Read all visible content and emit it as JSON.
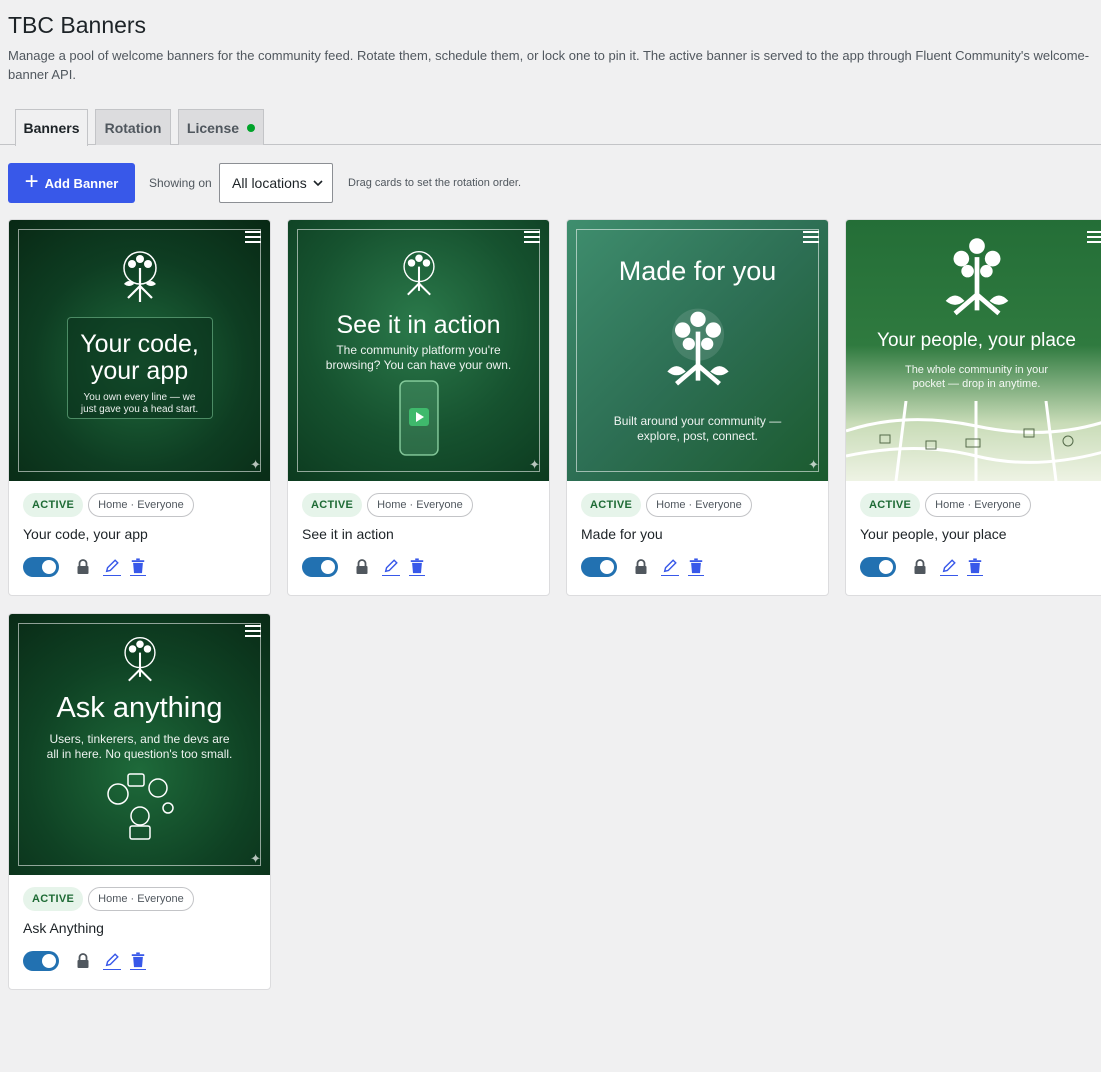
{
  "page": {
    "title": "TBC Banners",
    "description": "Manage a pool of welcome banners for the community feed. Rotate them, schedule them, or lock one to pin it. The active banner is served to the app through Fluent Community's welcome-banner API."
  },
  "tabs": [
    {
      "label": "Banners",
      "active": true
    },
    {
      "label": "Rotation",
      "active": false
    },
    {
      "label": "License",
      "active": false,
      "status_color": "#00a32a"
    }
  ],
  "toolbar": {
    "add_label": "Add Banner",
    "showing_label": "Showing on",
    "location_value": "All locations",
    "drag_hint": "Drag cards to set the rotation order."
  },
  "colors": {
    "accent": "#3858e9",
    "toggle_on": "#2271b1",
    "active_badge_bg": "#e6f4ea",
    "active_badge_text": "#1e6b35"
  },
  "cards": [
    {
      "title": "Your code, your app",
      "status": "ACTIVE",
      "location": "Home · Everyone",
      "enabled": true,
      "banner": {
        "headline_1": "Your code,",
        "headline_2": "your app",
        "sub_1": "You own every line — we",
        "sub_2": "just gave you a head start."
      }
    },
    {
      "title": "See it in action",
      "status": "ACTIVE",
      "location": "Home · Everyone",
      "enabled": true,
      "banner": {
        "headline_1": "See it in action",
        "sub_1": "The community platform you're",
        "sub_2": "browsing? You can have your own."
      }
    },
    {
      "title": "Made for you",
      "status": "ACTIVE",
      "location": "Home · Everyone",
      "enabled": true,
      "banner": {
        "headline_1": "Made for you",
        "sub_1": "Built around your community —",
        "sub_2": "explore, post, connect."
      }
    },
    {
      "title": "Your people, your place",
      "status": "ACTIVE",
      "location": "Home · Everyone",
      "enabled": true,
      "banner": {
        "headline_1": "Your people, your place",
        "sub_1": "The whole community in your",
        "sub_2": "pocket — drop in anytime."
      }
    },
    {
      "title": "Ask Anything",
      "status": "ACTIVE",
      "location": "Home · Everyone",
      "enabled": true,
      "banner": {
        "headline_1": "Ask anything",
        "sub_1": "Users, tinkerers, and the devs are",
        "sub_2": "all in here. No question's too small."
      }
    }
  ]
}
